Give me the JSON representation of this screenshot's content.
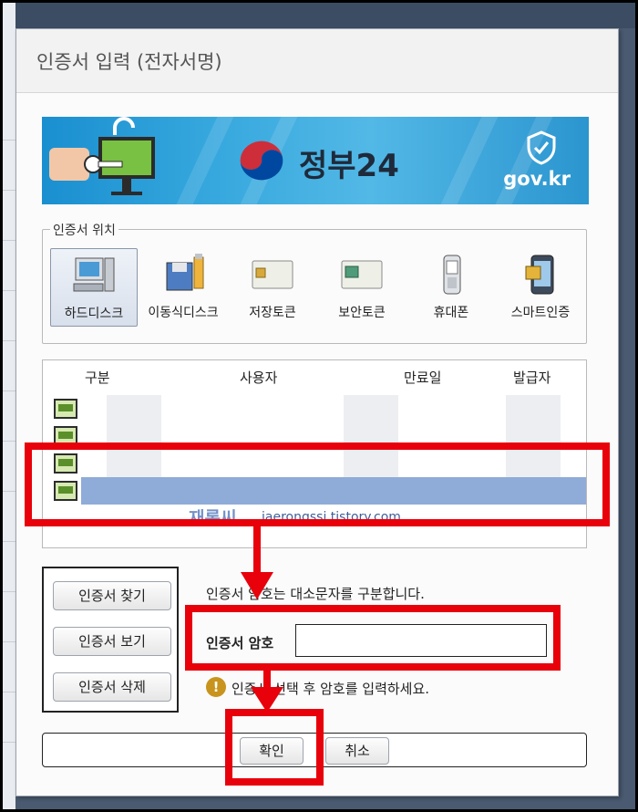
{
  "dialog": {
    "title": "인증서 입력 (전자서명)"
  },
  "banner": {
    "brand_name": "정부24",
    "domain": "gov.kr"
  },
  "location": {
    "legend": "인증서 위치",
    "items": [
      {
        "label": "하드디스크",
        "icon": "hard-disk-icon",
        "selected": true
      },
      {
        "label": "이동식디스크",
        "icon": "removable-disk-icon",
        "selected": false
      },
      {
        "label": "저장토큰",
        "icon": "storage-token-icon",
        "selected": false
      },
      {
        "label": "보안토큰",
        "icon": "security-token-icon",
        "selected": false
      },
      {
        "label": "휴대폰",
        "icon": "mobile-phone-icon",
        "selected": false
      },
      {
        "label": "스마트인증",
        "icon": "smart-auth-icon",
        "selected": false
      }
    ]
  },
  "cert_list": {
    "columns": [
      "구분",
      "사용자",
      "만료일",
      "발급자"
    ],
    "rows": 4,
    "selected_row": 4
  },
  "watermark": {
    "name": "재롱씨",
    "url": "jaerongssi.tistory.com"
  },
  "side_buttons": {
    "find": "인증서 찾기",
    "view": "인증서 보기",
    "delete": "인증서 삭제"
  },
  "password": {
    "note": "인증서 암호는 대소문자를 구분합니다.",
    "label": "인증서 암호",
    "value": "",
    "hint": "인증서 선택 후 암호를 입력하세요."
  },
  "actions": {
    "confirm": "확인",
    "cancel": "취소"
  },
  "colors": {
    "highlight": "#e8000b",
    "selected_row": "#8fabd8",
    "banner": "#35a7dd"
  }
}
